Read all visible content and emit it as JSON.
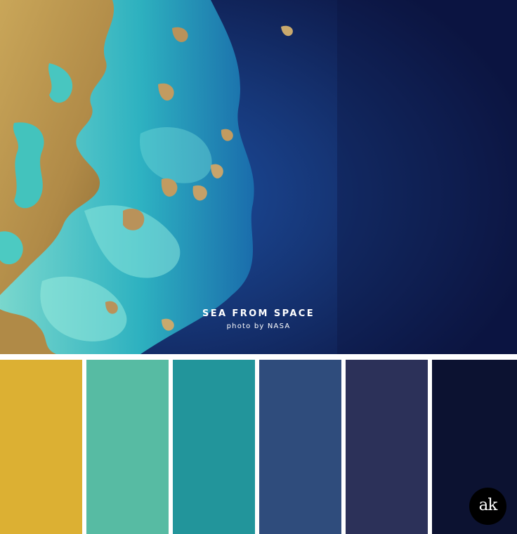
{
  "caption": {
    "title": "SEA FROM SPACE",
    "credit": "photo by NASA"
  },
  "photo": {
    "colors": {
      "deep_ocean": "#0f1a48",
      "mid_ocean": "#1e3c86",
      "turquoise": "#1fa6b4",
      "light_aqua": "#5fd0cf",
      "land": "#b99a4e",
      "land_dark": "#8f7037"
    }
  },
  "palette": {
    "swatches": [
      {
        "color": "#dcb033"
      },
      {
        "color": "#57bba3"
      },
      {
        "color": "#22959b"
      },
      {
        "color": "#2f4c7c"
      },
      {
        "color": "#2c3159"
      },
      {
        "color": "#0c1231"
      }
    ]
  },
  "logo": {
    "text": "ak"
  }
}
